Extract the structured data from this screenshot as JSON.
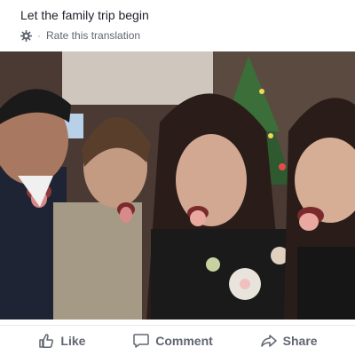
{
  "post": {
    "text": "Let the family trip begin",
    "translation": {
      "icon": "gear-icon",
      "separator": "·",
      "rate_label": "Rate this translation"
    }
  },
  "photo": {
    "icon": "photo-image"
  },
  "actions": {
    "like": {
      "label": "Like",
      "icon": "thumbs-up-icon"
    },
    "comment": {
      "label": "Comment",
      "icon": "comment-icon"
    },
    "share": {
      "label": "Share",
      "icon": "share-icon"
    }
  },
  "colors": {
    "text_primary": "#1d2129",
    "text_secondary": "#606770",
    "divider": "#e9ebee"
  }
}
